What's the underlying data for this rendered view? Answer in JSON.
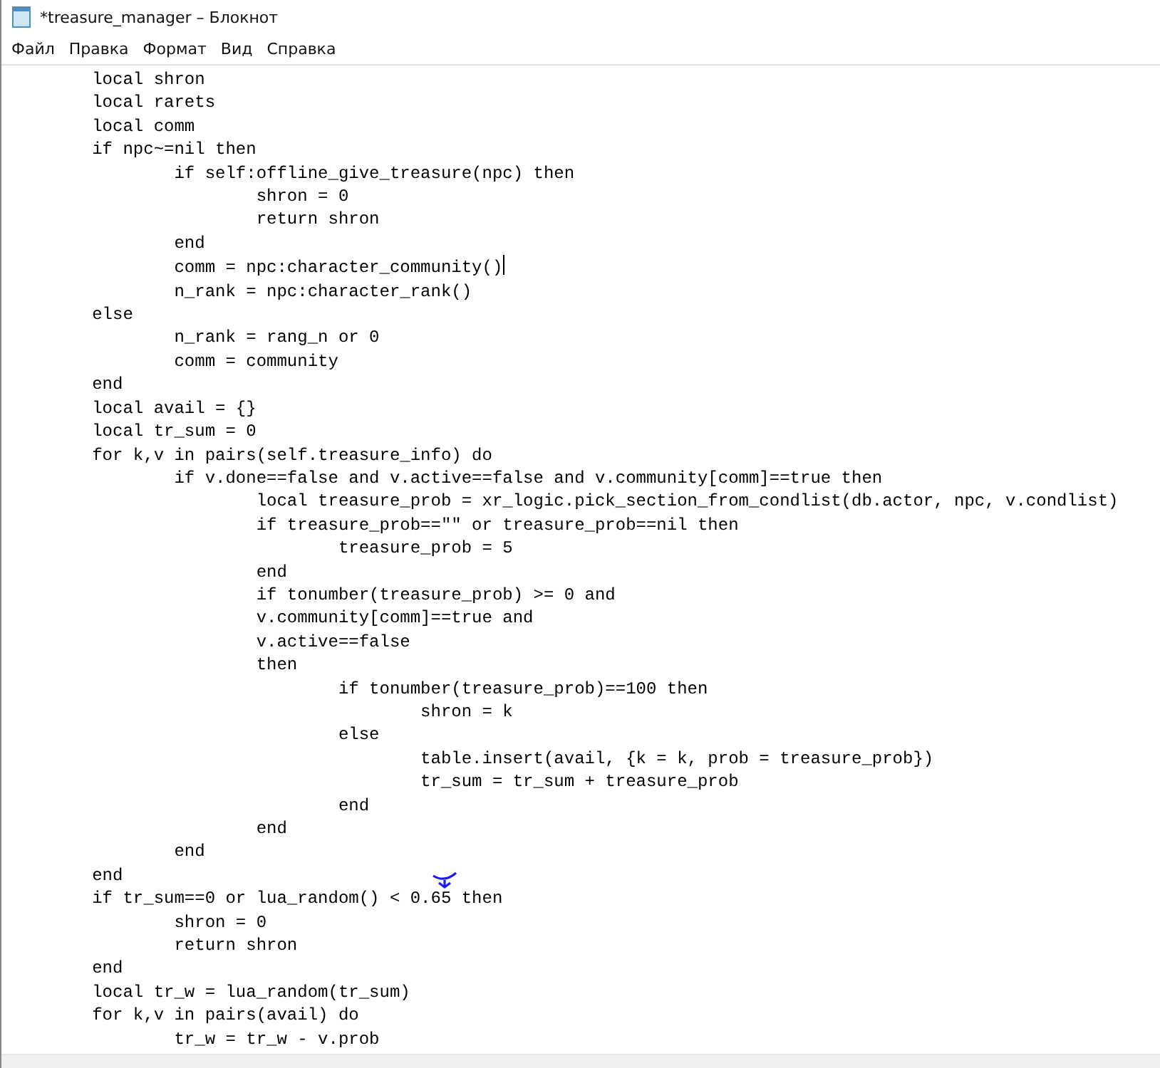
{
  "window": {
    "title": "*treasure_manager – Блокнот"
  },
  "menu": [
    "Файл",
    "Правка",
    "Формат",
    "Вид",
    "Справка"
  ],
  "editor": {
    "lines": [
      {
        "text": "\tlocal shron",
        "cursor": false
      },
      {
        "text": "\tlocal rarets",
        "cursor": false
      },
      {
        "text": "\tlocal comm",
        "cursor": false
      },
      {
        "text": "\tif npc~=nil then",
        "cursor": false
      },
      {
        "text": "\t\tif self:offline_give_treasure(npc) then",
        "cursor": false
      },
      {
        "text": "\t\t\tshron = 0",
        "cursor": false
      },
      {
        "text": "\t\t\treturn shron",
        "cursor": false
      },
      {
        "text": "\t\tend",
        "cursor": false
      },
      {
        "text": "\t\tcomm = npc:character_community()",
        "cursor": true
      },
      {
        "text": "\t\tn_rank = npc:character_rank()",
        "cursor": false
      },
      {
        "text": "\telse",
        "cursor": false
      },
      {
        "text": "\t\tn_rank = rang_n or 0",
        "cursor": false
      },
      {
        "text": "\t\tcomm = community",
        "cursor": false
      },
      {
        "text": "\tend",
        "cursor": false
      },
      {
        "text": "\tlocal avail = {}",
        "cursor": false
      },
      {
        "text": "\tlocal tr_sum = 0",
        "cursor": false
      },
      {
        "text": "\tfor k,v in pairs(self.treasure_info) do",
        "cursor": false
      },
      {
        "text": "\t\tif v.done==false and v.active==false and v.community[comm]==true then",
        "cursor": false
      },
      {
        "text": "\t\t\tlocal treasure_prob = xr_logic.pick_section_from_condlist(db.actor, npc, v.condlist)",
        "cursor": false
      },
      {
        "text": "\t\t\tif treasure_prob==\"\" or treasure_prob==nil then",
        "cursor": false
      },
      {
        "text": "\t\t\t\ttreasure_prob = 5",
        "cursor": false
      },
      {
        "text": "\t\t\tend",
        "cursor": false
      },
      {
        "text": "\t\t\tif tonumber(treasure_prob) >= 0 and",
        "cursor": false
      },
      {
        "text": "\t\t\tv.community[comm]==true and",
        "cursor": false
      },
      {
        "text": "\t\t\tv.active==false",
        "cursor": false
      },
      {
        "text": "\t\t\tthen",
        "cursor": false
      },
      {
        "text": "\t\t\t\tif tonumber(treasure_prob)==100 then",
        "cursor": false
      },
      {
        "text": "\t\t\t\t\tshron = k",
        "cursor": false
      },
      {
        "text": "\t\t\t\telse",
        "cursor": false
      },
      {
        "text": "\t\t\t\t\ttable.insert(avail, {k = k, prob = treasure_prob})",
        "cursor": false
      },
      {
        "text": "\t\t\t\t\ttr_sum = tr_sum + treasure_prob",
        "cursor": false
      },
      {
        "text": "\t\t\t\tend",
        "cursor": false
      },
      {
        "text": "\t\t\tend",
        "cursor": false
      },
      {
        "text": "\t\tend",
        "cursor": false
      },
      {
        "text": "\tend",
        "cursor": false
      },
      {
        "text": "\tif tr_sum==0 or lua_random() < 0.65 then",
        "cursor": false
      },
      {
        "text": "\t\tshron = 0",
        "cursor": false
      },
      {
        "text": "\t\treturn shron",
        "cursor": false
      },
      {
        "text": "\tend",
        "cursor": false
      },
      {
        "text": "\tlocal tr_w = lua_random(tr_sum)",
        "cursor": false
      },
      {
        "text": "\tfor k,v in pairs(avail) do",
        "cursor": false
      },
      {
        "text": "\t\ttr_w = tr_w - v.prob",
        "cursor": false
      }
    ]
  }
}
